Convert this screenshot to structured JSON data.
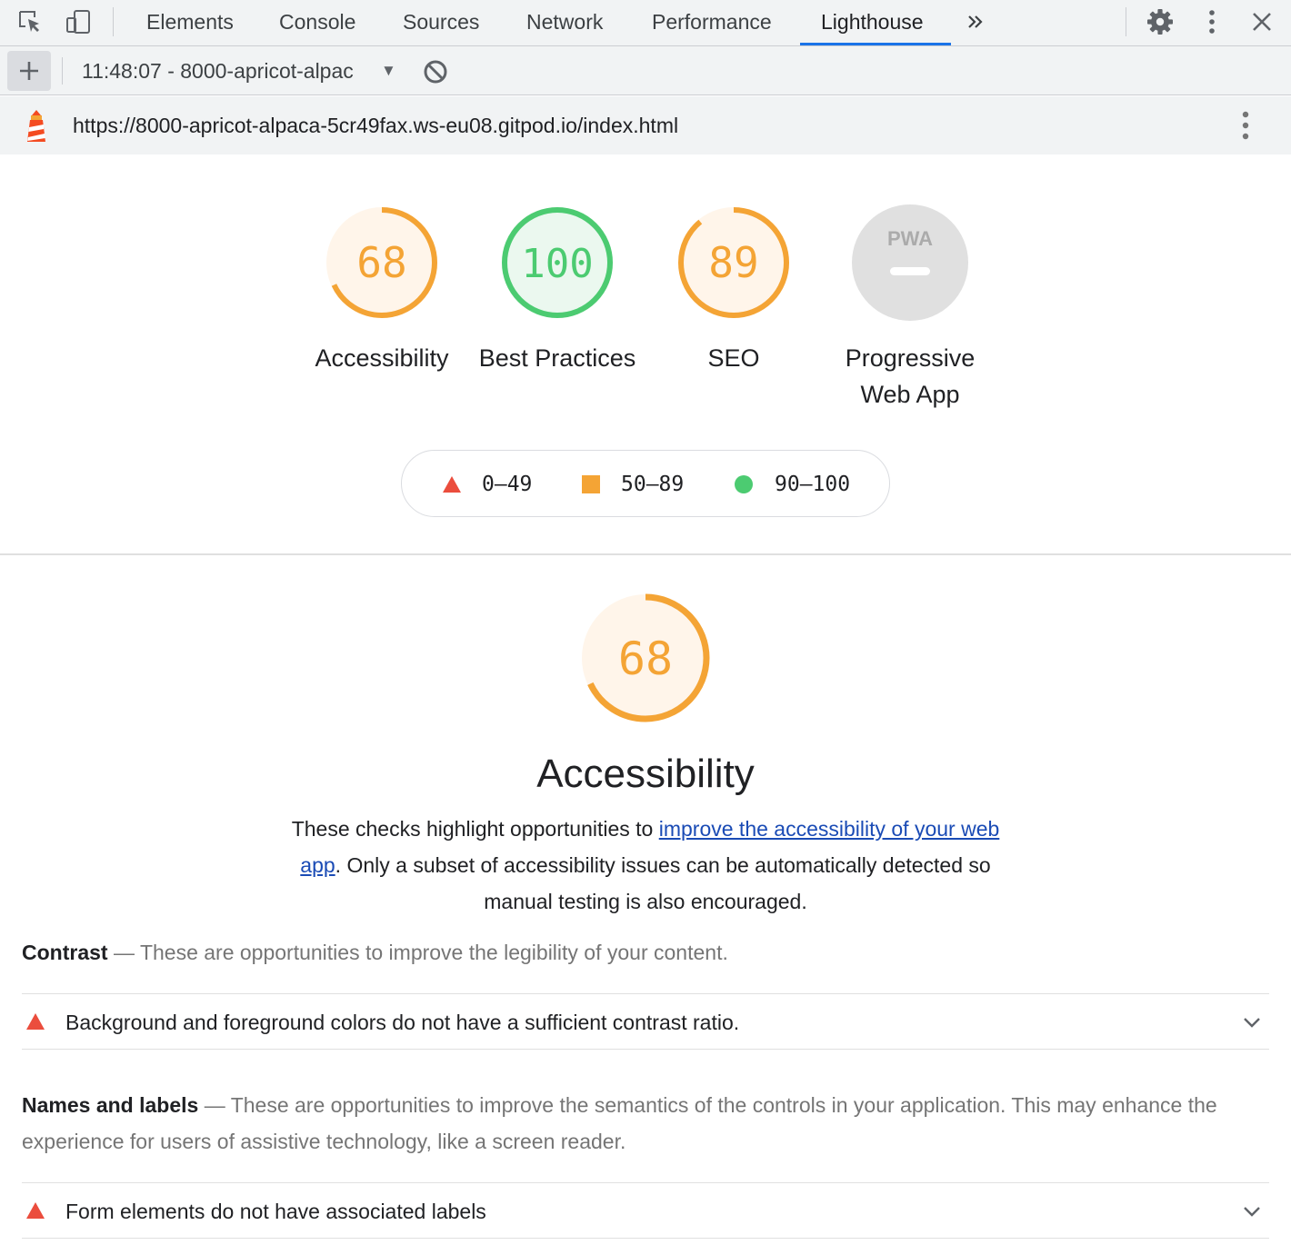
{
  "devtools": {
    "tabs": [
      {
        "label": "Elements"
      },
      {
        "label": "Console"
      },
      {
        "label": "Sources"
      },
      {
        "label": "Network"
      },
      {
        "label": "Performance"
      },
      {
        "label": "Lighthouse"
      }
    ],
    "active_tab": "Lighthouse"
  },
  "toolbar": {
    "report_selector": "11:48:07 - 8000-apricot-alpac"
  },
  "urlbar": {
    "url": "https://8000-apricot-alpaca-5cr49fax.ws-eu08.gitpod.io/index.html"
  },
  "colors": {
    "average": "#f4a435",
    "pass": "#0cce6b",
    "fail": "#eb4d3d",
    "pwa_grey": "#e0e0e0",
    "link": "#1a4bb5"
  },
  "scores": [
    {
      "category": "Accessibility",
      "score": "68",
      "rating": "average"
    },
    {
      "category": "Best Practices",
      "score": "100",
      "rating": "pass"
    },
    {
      "category": "SEO",
      "score": "89",
      "rating": "average"
    },
    {
      "category": "Progressive Web App",
      "score": "",
      "badge": "PWA",
      "rating": "not-applicable"
    }
  ],
  "legend": {
    "fail_range": "0–49",
    "average_range": "50–89",
    "pass_range": "90–100"
  },
  "category": {
    "score": "68",
    "title": "Accessibility",
    "desc_before": "These checks highlight opportunities to ",
    "desc_link": "improve the accessibility of your web app",
    "desc_after": ". Only a subset of accessibility issues can be automatically detected so manual testing is also encouraged."
  },
  "groups": [
    {
      "title": "Contrast",
      "description": "These are opportunities to improve the legibility of your content.",
      "audits": [
        "Background and foreground colors do not have a sufficient contrast ratio."
      ]
    },
    {
      "title": "Names and labels",
      "description": "These are opportunities to improve the semantics of the controls in your application. This may enhance the experience for users of assistive technology, like a screen reader.",
      "audits": [
        "Form elements do not have associated labels"
      ]
    }
  ]
}
